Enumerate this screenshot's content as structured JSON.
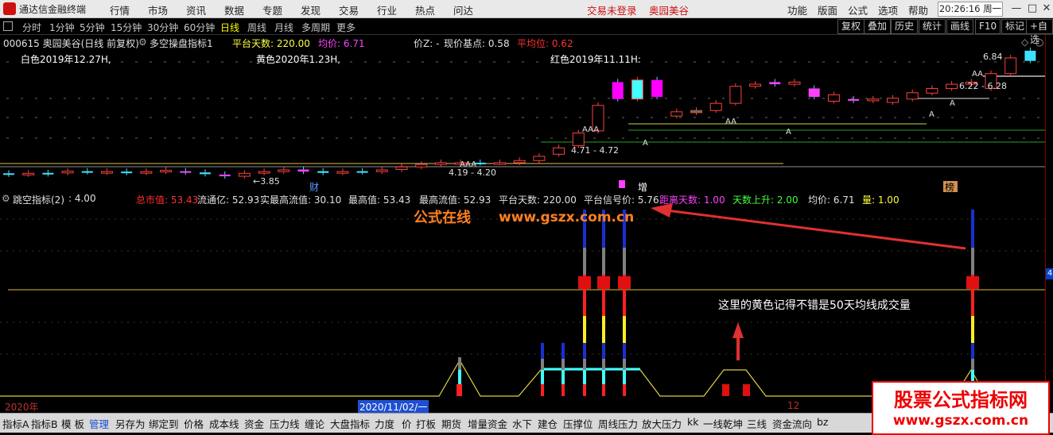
{
  "app": {
    "title": "通达信金融终端"
  },
  "menu": {
    "items": [
      "行情",
      "市场",
      "资讯",
      "数据",
      "专题",
      "发现",
      "交易",
      "行业",
      "热点",
      "问达"
    ],
    "alert": "交易未登录",
    "stock_name": "奥园美谷",
    "right_items": [
      "功能",
      "版面",
      "公式",
      "选项",
      "帮助"
    ],
    "clock": "20:26:16",
    "weekday": "周一"
  },
  "periods": {
    "items": [
      "分时",
      "1分钟",
      "5分钟",
      "15分钟",
      "30分钟",
      "60分钟",
      "日线",
      "周线",
      "月线",
      "多周期",
      "更多"
    ],
    "active": "日线",
    "tools": [
      "复权",
      "叠加",
      "历史",
      "统计",
      "画线",
      "F10",
      "标记",
      "+自选"
    ]
  },
  "price_panel": {
    "title": "000615 奥园美谷(日线 前复权)",
    "indicator": "多空操盘指标1",
    "platform_days_label": "平台天数: 220.00",
    "avg_price_label": "均价: 6.71",
    "price_z_label": "价Z: -",
    "base_point_label": "现价基点: 0.58",
    "flat_avg_label": "平均位: 0.62",
    "white_label": "白色2019年12.27H,",
    "yellow_label": "黄色2020年1.23H,",
    "red_label": "红色2019年11.11H:",
    "annotations": {
      "high": "6.84",
      "range_high": "6.22 - 6.28",
      "range_mid": "4.71 - 4.72",
      "range_low": "4.19 - 4.20",
      "low": "3.85",
      "aa": "AA",
      "aaa": "AAA",
      "a": "A",
      "caiwu": "财",
      "zeng": "增",
      "bang": "榜"
    }
  },
  "indicator_panel": {
    "name": "跳空指标(2)",
    "value": ": 4.00",
    "stats": [
      {
        "text": "总市值: 53.43",
        "color": "#ff3030"
      },
      {
        "text": "流通亿: 52.93",
        "color": "#e0e0e0"
      },
      {
        "text": "实最高流值: 30.10",
        "color": "#e0e0e0"
      },
      {
        "text": "最高值: 53.43",
        "color": "#e0e0e0"
      },
      {
        "text": "最高流值: 52.93",
        "color": "#e0e0e0"
      },
      {
        "text": "平台天数: 220.00",
        "color": "#e0e0e0"
      },
      {
        "text": "平台信号价: 5.76",
        "color": "#e0e0e0"
      },
      {
        "text": "距离天数: 1.00",
        "color": "#ff40ff"
      },
      {
        "text": "天数上升: 2.00",
        "color": "#40ff40"
      },
      {
        "text": "均价: 6.71",
        "color": "#e0e0e0"
      },
      {
        "text": "量: 1.00",
        "color": "#ffff40"
      }
    ],
    "watermark_text": "公式在线",
    "watermark_url": "www.gszx.com.cn",
    "note": "这里的黄色记得不错是50天均线成交量",
    "right_value": "4"
  },
  "datebar": {
    "year": "2020年",
    "date": "2020/11/02/一",
    "month": "12"
  },
  "tabs": {
    "items": [
      "指标A",
      "指标B",
      "模 板",
      "管理",
      "另存为",
      "绑定到",
      "价格",
      "成本线",
      "资金",
      "压力线",
      "缠论",
      "大盘指标",
      "力度",
      "价",
      "打板",
      "期货",
      "增量资金",
      "水下",
      "建仓",
      "压撑位",
      "周线压力",
      "放大压力",
      "kk",
      "一线乾坤",
      "三线",
      "资金流向",
      "bz"
    ],
    "active": "管理"
  },
  "watermark_box": {
    "title": "股票公式指标网",
    "url": "www.gszx.com.cn"
  },
  "chart_data": {
    "type": "candlestick",
    "note_series": "daily candles (approx. open/close)",
    "candles": [
      [
        3.95,
        3.92
      ],
      [
        3.92,
        3.95
      ],
      [
        3.96,
        3.93
      ],
      [
        3.96,
        4.0
      ],
      [
        4.0,
        3.98
      ],
      [
        3.97,
        3.99
      ],
      [
        3.99,
        3.96
      ],
      [
        3.96,
        3.99
      ],
      [
        3.99,
        4.02
      ],
      [
        4.0,
        3.97
      ],
      [
        3.97,
        3.93
      ],
      [
        3.92,
        3.88
      ],
      [
        3.88,
        3.95
      ],
      [
        3.96,
        3.99
      ],
      [
        3.99,
        4.03
      ],
      [
        4.04,
        3.99
      ],
      [
        4.0,
        3.96
      ],
      [
        3.96,
        3.99
      ],
      [
        4.0,
        3.98
      ],
      [
        3.99,
        4.03
      ],
      [
        4.04,
        4.1
      ],
      [
        4.1,
        4.16
      ],
      [
        4.16,
        4.2
      ],
      [
        4.19,
        4.2
      ],
      [
        4.2,
        4.19
      ],
      [
        4.2,
        4.2
      ],
      [
        4.2,
        4.25
      ],
      [
        4.25,
        4.35
      ],
      [
        4.4,
        4.55
      ],
      [
        4.6,
        4.9
      ],
      [
        4.95,
        5.55
      ],
      [
        6.1,
        5.7
      ],
      [
        5.7,
        6.15
      ],
      [
        6.15,
        5.75
      ],
      [
        5.3,
        5.4
      ],
      [
        5.38,
        5.43
      ],
      [
        5.43,
        5.6
      ],
      [
        5.6,
        6.0
      ],
      [
        6.0,
        6.05
      ],
      [
        6.1,
        6.05
      ],
      [
        6.05,
        6.1
      ],
      [
        5.95,
        5.75
      ],
      [
        5.65,
        5.8
      ],
      [
        5.7,
        5.66
      ],
      [
        5.66,
        5.7
      ],
      [
        5.62,
        5.72
      ],
      [
        5.7,
        5.85
      ],
      [
        5.84,
        5.95
      ],
      [
        5.95,
        6.05
      ],
      [
        6.05,
        6.1
      ],
      [
        5.95,
        6.3
      ],
      [
        6.3,
        6.67
      ],
      [
        6.84,
        6.6
      ]
    ]
  }
}
